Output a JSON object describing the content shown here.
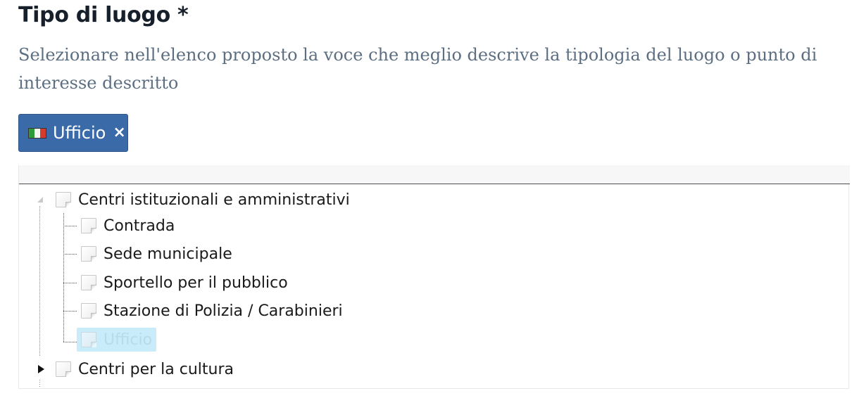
{
  "field": {
    "title": "Tipo di luogo *",
    "help_text": "Selezionare nell'elenco proposto la voce che meglio descrive la tipologia del luogo o punto di interesse descritto"
  },
  "selected_chip": {
    "label": "Ufficio",
    "flag_icon": "italy-flag-icon",
    "remove_symbol": "×"
  },
  "tree": {
    "nodes": [
      {
        "label": "Centri istituzionali e amministrativi",
        "state": "expanded",
        "children": [
          {
            "label": "Contrada"
          },
          {
            "label": "Sede municipale"
          },
          {
            "label": "Sportello per il pubblico"
          },
          {
            "label": "Stazione di Polizia / Carabinieri"
          },
          {
            "label": "Ufficio",
            "selected": true
          }
        ]
      },
      {
        "label": "Centri per la cultura",
        "state": "collapsed"
      }
    ]
  },
  "colors": {
    "chip_background": "#3a6aa8",
    "selected_node_background": "#c9ecfa",
    "help_text": "#5c6f82"
  }
}
